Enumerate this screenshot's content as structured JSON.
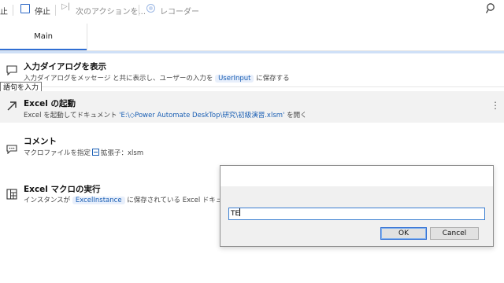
{
  "toolbar": {
    "run_label": "止",
    "stop_label": "停止",
    "next_action_label": "次のアクションを...",
    "recorder_label": "レコーダー"
  },
  "tabs": [
    {
      "label": "Main"
    }
  ],
  "tooltip": "語句を入力",
  "actions": [
    {
      "title": "入力ダイアログを表示",
      "desc_prefix": "入力ダイアログをメッセージ と共に表示し、ユーザーの入力を",
      "variable": "UserInput",
      "desc_suffix": "に保存する"
    },
    {
      "title": "Excel の起動",
      "desc_prefix": "Excel を起動してドキュメント",
      "path": "'E:\\◇Power Automate DeskTop\\研究\\初級演習.xlsm'",
      "desc_suffix": "を開く"
    },
    {
      "title": "コメント",
      "desc": "マクロファイルを指定",
      "desc_tail": "拡張子：xlsm"
    },
    {
      "title": "Excel マクロの実行",
      "desc_prefix": "インスタンスが",
      "variable": "ExcelInstance",
      "desc_suffix": "に保存されている Excel ドキュメ"
    }
  ],
  "dialog": {
    "input_value": "TE",
    "ok_label": "OK",
    "cancel_label": "Cancel"
  },
  "icons": [
    "stop-checkbox-icon",
    "play-next-icon",
    "recorder-icon",
    "search-icon",
    "message-box-icon",
    "arrow-up-right-icon",
    "comment-icon",
    "excel-macro-icon",
    "more-options-icon"
  ],
  "colors": {
    "accent": "#2f6ed3",
    "link": "#1a5fb4",
    "selected_row": "#f2f2f2"
  }
}
